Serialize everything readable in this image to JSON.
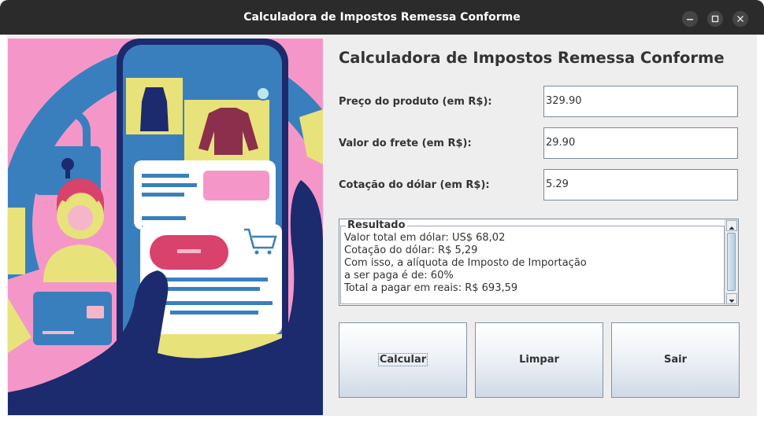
{
  "window": {
    "title": "Calculadora de Impostos Remessa Conforme"
  },
  "header": {
    "title": "Calculadora de Impostos Remessa Conforme"
  },
  "form": {
    "preco_label": "Preço do produto (em R$):",
    "preco_value": "329.90",
    "frete_label": "Valor do frete (em R$):",
    "frete_value": "29.90",
    "cotacao_label": "Cotação do dólar (em R$):",
    "cotacao_value": "5.29"
  },
  "resultado": {
    "legend": "Resultado",
    "lines": [
      "Valor total em dólar: US$ 68,02",
      "Cotação do dólar: R$ 5,29",
      "Com isso, a alíquota de Imposto de Importação",
      "a ser paga é de: 60%",
      "Total a pagar em reais: R$ 693,59"
    ]
  },
  "buttons": {
    "calcular": "Calcular",
    "limpar": "Limpar",
    "sair": "Sair"
  },
  "colors": {
    "titlebar": "#2b2b2b",
    "panel": "#eeeeee",
    "illustration_pink": "#f497c8",
    "illustration_blue": "#3a7fbd",
    "illustration_navy": "#1c2a6e",
    "illustration_yellow": "#e8e27a"
  },
  "icons": {
    "minimize": "minimize-icon",
    "maximize": "maximize-icon",
    "close": "close-icon"
  }
}
